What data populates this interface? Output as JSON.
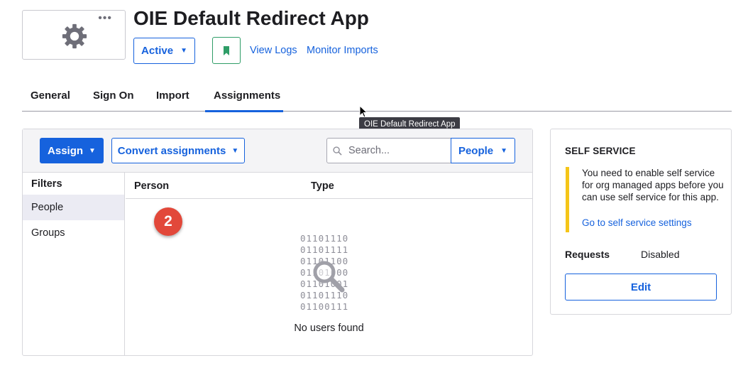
{
  "app": {
    "title": "OIE Default Redirect App",
    "logo_icon": "gear-icon",
    "more_label": "•••",
    "status_label": "Active",
    "links": [
      "View Logs",
      "Monitor Imports"
    ]
  },
  "tabs": [
    {
      "label": "General",
      "active": false
    },
    {
      "label": "Sign On",
      "active": false
    },
    {
      "label": "Import",
      "active": false
    },
    {
      "label": "Assignments",
      "active": true
    }
  ],
  "tooltip": "OIE Default Redirect App",
  "toolbar": {
    "assign_label": "Assign",
    "convert_label": "Convert assignments",
    "search_placeholder": "Search...",
    "search_value": "",
    "type_dropdown": "People"
  },
  "filters": {
    "title": "Filters",
    "items": [
      {
        "label": "People",
        "selected": true
      },
      {
        "label": "Groups",
        "selected": false
      }
    ]
  },
  "table": {
    "columns": [
      "Person",
      "Type"
    ],
    "empty_text": "No users found",
    "empty_art_lines": [
      "01101110",
      "01101111",
      "01101100",
      "01101000",
      "01101001",
      "01101110",
      "01100111"
    ]
  },
  "step_badge": "2",
  "self_service": {
    "title": "SELF SERVICE",
    "notice": "You need to enable self service for org managed apps before you can use self service for this app.",
    "link": "Go to self service settings",
    "requests_label": "Requests",
    "requests_value": "Disabled",
    "edit_label": "Edit"
  },
  "colors": {
    "accent": "#1662dd",
    "badge": "#e2483a",
    "warning": "#f5c518",
    "bookmark": "#2f9d67"
  }
}
